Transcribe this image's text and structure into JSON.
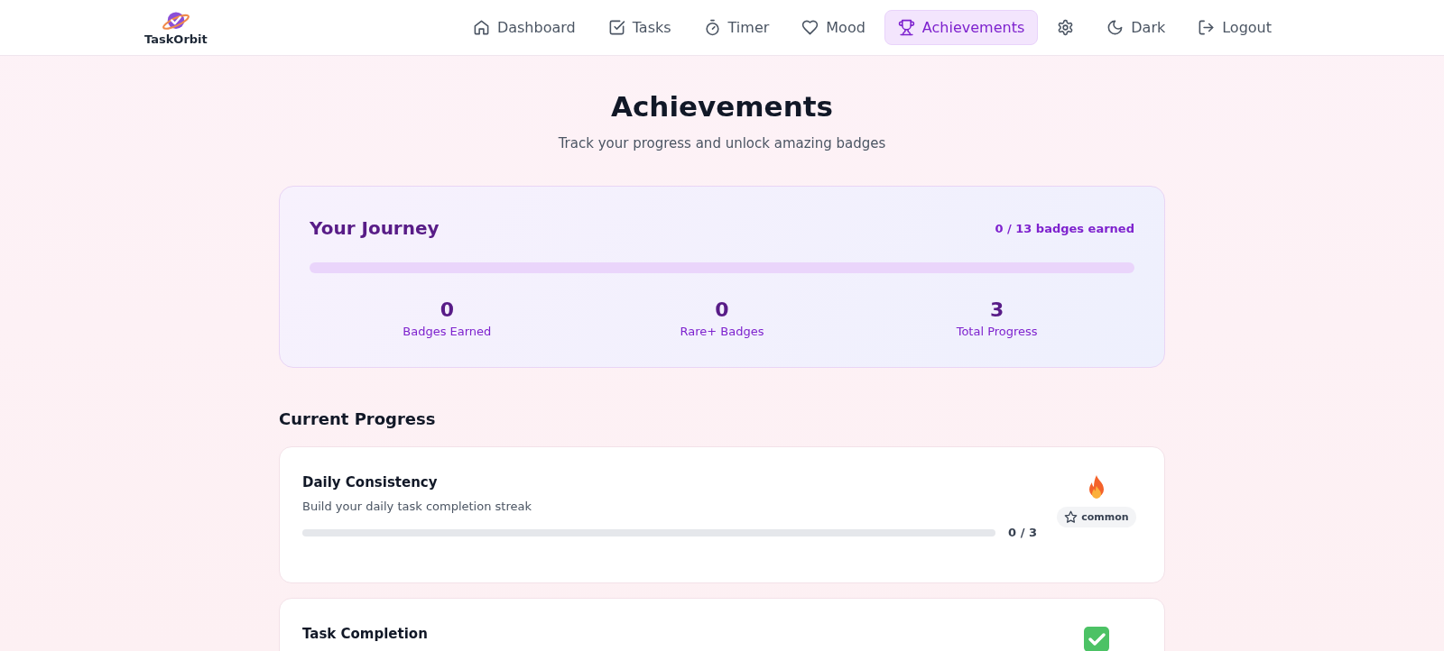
{
  "brand": {
    "name": "TaskOrbit"
  },
  "nav": [
    {
      "kind": "home",
      "label": "Dashboard",
      "selected": false
    },
    {
      "kind": "tasks",
      "label": "Tasks",
      "selected": false
    },
    {
      "kind": "timer",
      "label": "Timer",
      "selected": false
    },
    {
      "kind": "mood",
      "label": "Mood",
      "selected": false
    },
    {
      "kind": "trophy",
      "label": "Achievements",
      "selected": true
    },
    {
      "kind": "settings",
      "selected": false
    },
    {
      "kind": "moon",
      "label": "Dark",
      "selected": false
    },
    {
      "kind": "logout",
      "label": "Logout",
      "selected": false
    }
  ],
  "page": {
    "title": "Achievements",
    "subtitle": "Track your progress and unlock amazing badges"
  },
  "journey": {
    "title": "Your Journey",
    "count": "0 / 13 badges earned",
    "level": 0,
    "stats": [
      {
        "value": "0",
        "label": "Badges Earned"
      },
      {
        "value": "0",
        "label": "Rare+ Badges"
      },
      {
        "value": "3",
        "label": "Total Progress"
      }
    ]
  },
  "progress_section": {
    "title": "Current Progress",
    "items": [
      {
        "title": "Daily Consistency",
        "description": "Build your daily task completion streak",
        "level": 0,
        "reading": "0 / 3",
        "kind": "fire",
        "rarity": "common"
      },
      {
        "title": "Task Completion",
        "kind": "check"
      }
    ]
  }
}
